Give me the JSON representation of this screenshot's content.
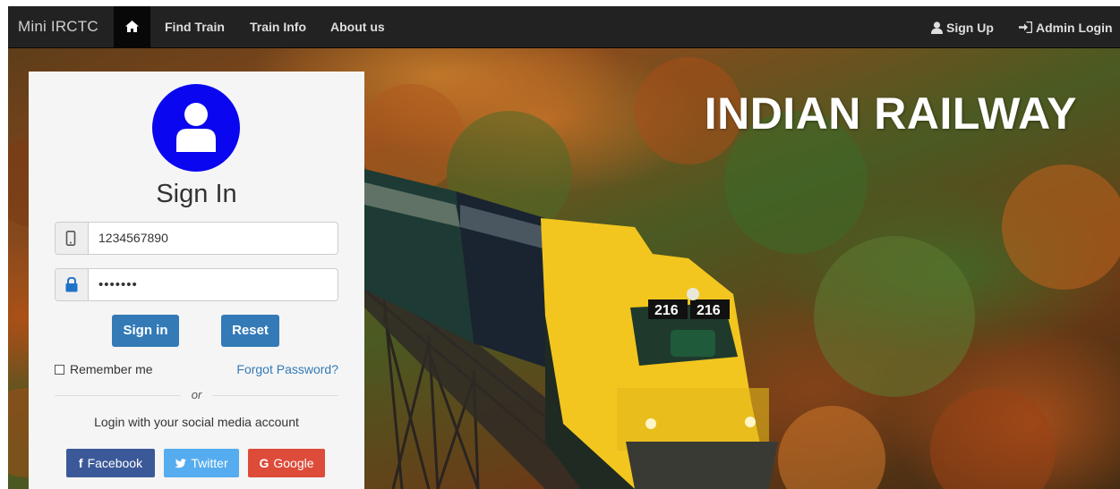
{
  "navbar": {
    "brand": "Mini IRCTC",
    "links": [
      "Find Train",
      "Train Info",
      "About us"
    ],
    "right": {
      "signup": "Sign Up",
      "admin_login": "Admin Login"
    }
  },
  "hero": {
    "title": "INDIAN RAILWAY",
    "locomotive_number": "216"
  },
  "login": {
    "title": "Sign In",
    "phone_value": "1234567890",
    "password_value": "•••••••",
    "signin_label": "Sign in",
    "reset_label": "Reset",
    "remember_label": "Remember me",
    "forgot_label": "Forgot Password?",
    "or_text": "or",
    "social_text": "Login with your social media account",
    "facebook_label": "Facebook",
    "twitter_label": "Twitter",
    "google_label": "Google"
  },
  "colors": {
    "navbar_bg": "#222222",
    "avatar_bg": "#0a06ef",
    "primary": "#337ab7",
    "facebook": "#3b5998",
    "twitter": "#55acee",
    "google": "#dd4b39",
    "locomotive_yellow": "#f2c61f"
  },
  "icons": {
    "home": "home-icon",
    "user": "user-icon",
    "login": "login-icon",
    "phone": "mobile-phone-icon",
    "lock": "lock-icon",
    "facebook": "facebook-icon",
    "twitter": "twitter-icon",
    "google": "google-icon"
  }
}
